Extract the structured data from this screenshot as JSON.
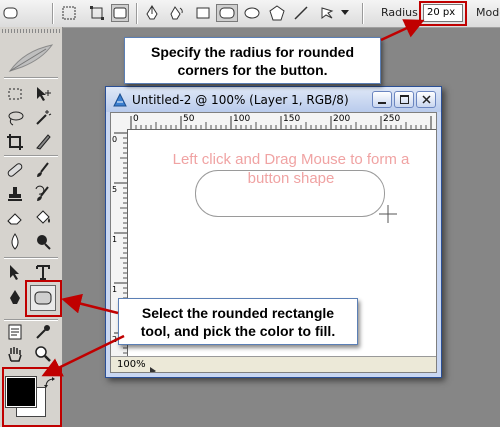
{
  "options_bar": {
    "radius_label": "Radius:",
    "radius_value": "20 px",
    "mode_label": "Mode"
  },
  "callouts": {
    "top": "Specify the radius for rounded corners for the button.",
    "bottom": "Select the rounded rectangle tool, and pick the color to fill."
  },
  "document": {
    "title": "Untitled-2 @ 100% (Layer 1, RGB/8)",
    "zoom": "100%",
    "ruler_h_labels": [
      "0",
      "50",
      "100",
      "150",
      "200",
      "250"
    ],
    "ruler_v_labels": [
      "0",
      "5",
      "1",
      "1",
      "2"
    ],
    "hint_text": "Left click and Drag Mouse to form a button shape"
  },
  "colors": {
    "highlight": "#c00000",
    "arrow": "#c00000",
    "hint_text": "#f0a3a3",
    "foreground_swatch": "#000000",
    "background_swatch": "#ffffff"
  }
}
